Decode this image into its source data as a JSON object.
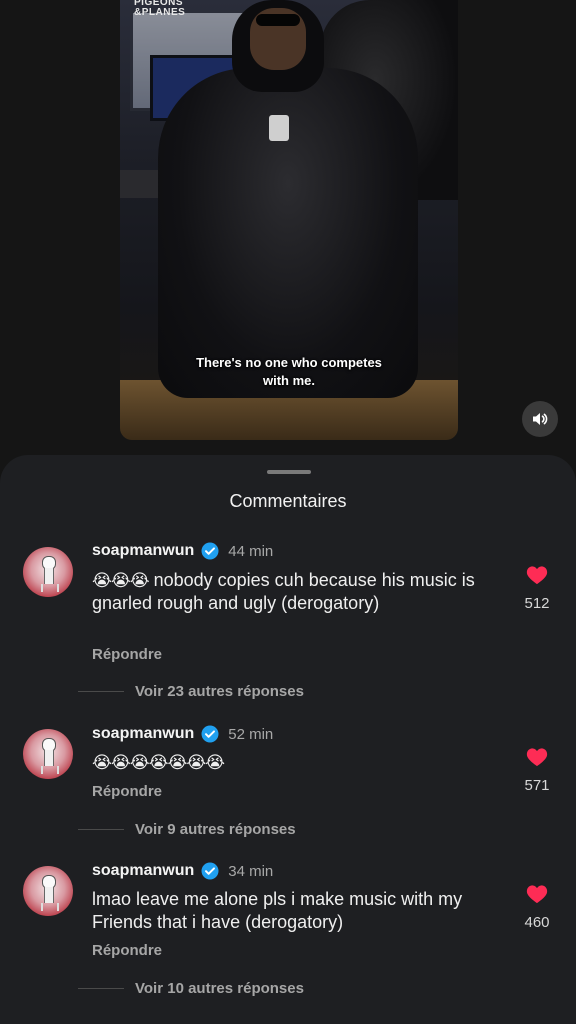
{
  "video": {
    "watermark_line1": "PIGEONS",
    "watermark_line2": "&PLANES",
    "caption_line1": "There's no one who competes",
    "caption_line2": "with me.",
    "sound_icon": "speaker-icon"
  },
  "sheet": {
    "title": "Commentaires"
  },
  "comments": [
    {
      "username": "soapmanwun",
      "time": "44 min",
      "emoji": "😭😭😭",
      "text": " nobody copies cuh because his music is gnarled rough and ugly (derogatory)",
      "reply_label": "Répondre",
      "more_replies": "Voir 23 autres réponses",
      "likes": "512"
    },
    {
      "username": "soapmanwun",
      "time": "52 min",
      "emoji": "😭😭😭😭😭😭😭",
      "text": "",
      "reply_label": "Répondre",
      "more_replies": "Voir 9 autres réponses",
      "likes": "571"
    },
    {
      "username": "soapmanwun",
      "time": "34 min",
      "emoji": "",
      "text": "lmao leave me alone pls i make music with my Friends that i have (derogatory)",
      "reply_label": "Répondre",
      "more_replies": "Voir 10 autres réponses",
      "likes": "460"
    }
  ],
  "colors": {
    "like_heart": "#fe2c55",
    "verified_badge": "#20a0f0",
    "sheet_background": "#1e1f22"
  }
}
